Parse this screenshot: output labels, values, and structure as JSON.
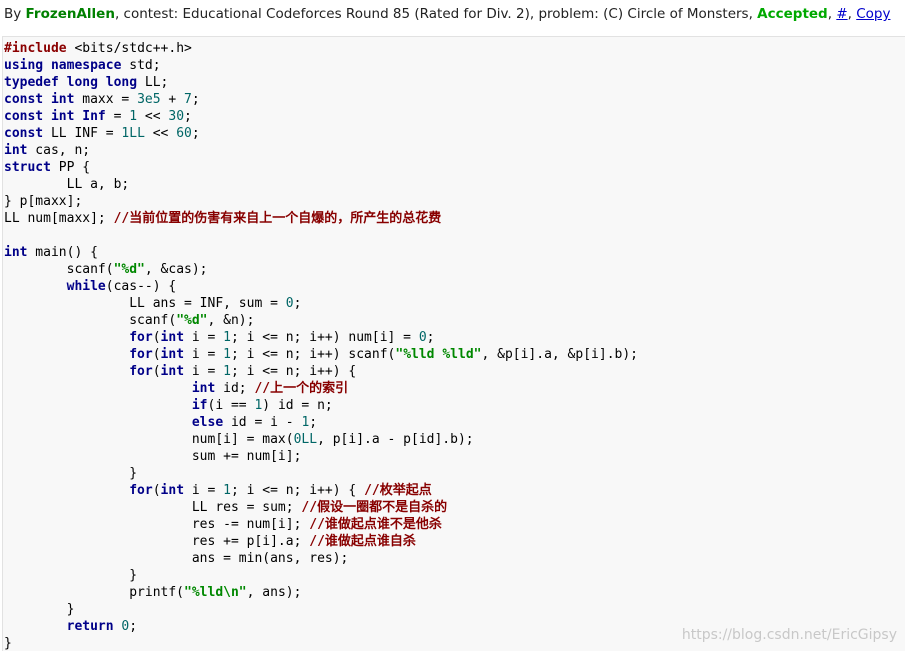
{
  "header": {
    "prefix": "By ",
    "author": "FrozenAllen",
    "contest_text": ", contest: Educational Codeforces Round 85 (Rated for Div. 2), problem: (C) Circle of Monsters, ",
    "verdict": "Accepted",
    "sep1": ", ",
    "hash_link": "#",
    "sep2": ", ",
    "copy_link": "Copy"
  },
  "code_lines": [
    [
      [
        "pp",
        "#include"
      ],
      [
        "",
        "&nbsp;"
      ],
      [
        "",
        "<bits/stdc++.h>"
      ]
    ],
    [
      [
        "kw",
        "using"
      ],
      [
        "",
        " "
      ],
      [
        "kw",
        "namespace"
      ],
      [
        "",
        " std;"
      ]
    ],
    [
      [
        "kw",
        "typedef"
      ],
      [
        "",
        " "
      ],
      [
        "ty",
        "long long"
      ],
      [
        "",
        " LL;"
      ]
    ],
    [
      [
        "kw",
        "const"
      ],
      [
        "",
        " "
      ],
      [
        "ty",
        "int"
      ],
      [
        "",
        " maxx = "
      ],
      [
        "lit",
        "3e5"
      ],
      [
        "",
        " + "
      ],
      [
        "lit",
        "7"
      ],
      [
        "",
        ";"
      ]
    ],
    [
      [
        "kw",
        "const"
      ],
      [
        "",
        " "
      ],
      [
        "ty",
        "int"
      ],
      [
        "",
        " "
      ],
      [
        "kw",
        "Inf"
      ],
      [
        "",
        " = "
      ],
      [
        "lit",
        "1"
      ],
      [
        "",
        " << "
      ],
      [
        "lit",
        "30"
      ],
      [
        "",
        ";"
      ]
    ],
    [
      [
        "kw",
        "const"
      ],
      [
        "",
        " LL INF = "
      ],
      [
        "lit",
        "1LL"
      ],
      [
        "",
        " << "
      ],
      [
        "lit",
        "60"
      ],
      [
        "",
        ";"
      ]
    ],
    [
      [
        "ty",
        "int"
      ],
      [
        "",
        " cas, n;"
      ]
    ],
    [
      [
        "kw",
        "struct"
      ],
      [
        "",
        " PP {"
      ]
    ],
    [
      [
        "",
        "        LL a, b;"
      ]
    ],
    [
      [
        "",
        "} p[maxx];"
      ]
    ],
    [
      [
        "",
        "LL num[maxx]; "
      ],
      [
        "com",
        "//当前位置的伤害有来自上一个自爆的，所产生的总花费"
      ]
    ],
    [
      [
        "",
        ""
      ]
    ],
    [
      [
        "ty",
        "int"
      ],
      [
        "",
        " main() {"
      ]
    ],
    [
      [
        "",
        "        scanf("
      ],
      [
        "str",
        "\"%d\""
      ],
      [
        "",
        ", &cas);"
      ]
    ],
    [
      [
        "",
        "        "
      ],
      [
        "kw",
        "while"
      ],
      [
        "",
        "(cas--) {"
      ]
    ],
    [
      [
        "",
        "                LL ans = INF, sum = "
      ],
      [
        "lit",
        "0"
      ],
      [
        "",
        ";"
      ]
    ],
    [
      [
        "",
        "                scanf("
      ],
      [
        "str",
        "\"%d\""
      ],
      [
        "",
        ", &n);"
      ]
    ],
    [
      [
        "",
        "                "
      ],
      [
        "kw",
        "for"
      ],
      [
        "",
        "("
      ],
      [
        "ty",
        "int"
      ],
      [
        "",
        " i = "
      ],
      [
        "lit",
        "1"
      ],
      [
        "",
        "; i <= n; i++) num[i] = "
      ],
      [
        "lit",
        "0"
      ],
      [
        "",
        ";"
      ]
    ],
    [
      [
        "",
        "                "
      ],
      [
        "kw",
        "for"
      ],
      [
        "",
        "("
      ],
      [
        "ty",
        "int"
      ],
      [
        "",
        " i = "
      ],
      [
        "lit",
        "1"
      ],
      [
        "",
        "; i <= n; i++) scanf("
      ],
      [
        "str",
        "\"%lld %lld\""
      ],
      [
        "",
        ", &p[i].a, &p[i].b);"
      ]
    ],
    [
      [
        "",
        "                "
      ],
      [
        "kw",
        "for"
      ],
      [
        "",
        "("
      ],
      [
        "ty",
        "int"
      ],
      [
        "",
        " i = "
      ],
      [
        "lit",
        "1"
      ],
      [
        "",
        "; i <= n; i++) {"
      ]
    ],
    [
      [
        "",
        "                        "
      ],
      [
        "ty",
        "int"
      ],
      [
        "",
        " id; "
      ],
      [
        "com",
        "//上一个的索引"
      ]
    ],
    [
      [
        "",
        "                        "
      ],
      [
        "kw",
        "if"
      ],
      [
        "",
        "(i == "
      ],
      [
        "lit",
        "1"
      ],
      [
        "",
        ") id = n;"
      ]
    ],
    [
      [
        "",
        "                        "
      ],
      [
        "kw",
        "else"
      ],
      [
        "",
        " id = i - "
      ],
      [
        "lit",
        "1"
      ],
      [
        "",
        ";"
      ]
    ],
    [
      [
        "",
        "                        num[i] = max("
      ],
      [
        "lit",
        "0LL"
      ],
      [
        "",
        ", p[i].a - p[id].b);"
      ]
    ],
    [
      [
        "",
        "                        sum += num[i];"
      ]
    ],
    [
      [
        "",
        "                }"
      ]
    ],
    [
      [
        "",
        "                "
      ],
      [
        "kw",
        "for"
      ],
      [
        "",
        "("
      ],
      [
        "ty",
        "int"
      ],
      [
        "",
        " i = "
      ],
      [
        "lit",
        "1"
      ],
      [
        "",
        "; i <= n; i++) { "
      ],
      [
        "com",
        "//枚举起点"
      ]
    ],
    [
      [
        "",
        "                        LL res = sum; "
      ],
      [
        "com",
        "//假设一圈都不是自杀的"
      ]
    ],
    [
      [
        "",
        "                        res -= num[i]; "
      ],
      [
        "com",
        "//谁做起点谁不是他杀"
      ]
    ],
    [
      [
        "",
        "                        res += p[i].a; "
      ],
      [
        "com",
        "//谁做起点谁自杀"
      ]
    ],
    [
      [
        "",
        "                        ans = min(ans, res);"
      ]
    ],
    [
      [
        "",
        "                }"
      ]
    ],
    [
      [
        "",
        "                printf("
      ],
      [
        "str",
        "\"%lld\\n\""
      ],
      [
        "",
        ", ans);"
      ]
    ],
    [
      [
        "",
        "        }"
      ]
    ],
    [
      [
        "",
        "        "
      ],
      [
        "kw",
        "return"
      ],
      [
        "",
        " "
      ],
      [
        "lit",
        "0"
      ],
      [
        "",
        ";"
      ]
    ],
    [
      [
        "",
        "}"
      ]
    ]
  ],
  "watermark": "https://blog.csdn.net/EricGipsy"
}
